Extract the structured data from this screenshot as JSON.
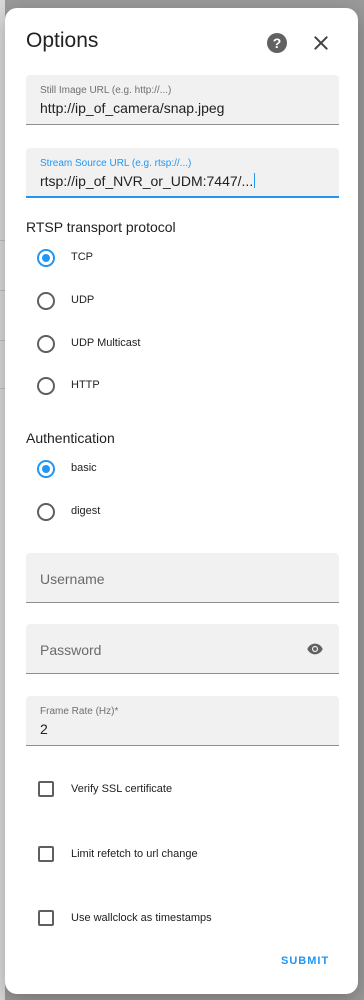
{
  "dialog": {
    "title": "Options",
    "help_icon": "help-circle-icon",
    "close_icon": "close-icon"
  },
  "fields": {
    "still_image": {
      "label": "Still Image URL (e.g. http://...)",
      "value": "http://ip_of_camera/snap.jpeg"
    },
    "stream_source": {
      "label": "Stream Source URL (e.g. rtsp://...)",
      "value": "rtsp://ip_of_NVR_or_UDM:7447/..."
    },
    "username": {
      "placeholder": "Username",
      "value": ""
    },
    "password": {
      "placeholder": "Password",
      "value": "",
      "toggle_icon": "eye-icon"
    },
    "frame_rate": {
      "label": "Frame Rate (Hz)*",
      "value": "2"
    }
  },
  "rtsp": {
    "title": "RTSP transport protocol",
    "options": [
      {
        "label": "TCP",
        "checked": true
      },
      {
        "label": "UDP",
        "checked": false
      },
      {
        "label": "UDP Multicast",
        "checked": false
      },
      {
        "label": "HTTP",
        "checked": false
      }
    ]
  },
  "auth": {
    "title": "Authentication",
    "options": [
      {
        "label": "basic",
        "checked": true
      },
      {
        "label": "digest",
        "checked": false
      }
    ]
  },
  "checkboxes": [
    {
      "label": "Verify SSL certificate",
      "checked": false
    },
    {
      "label": "Limit refetch to url change",
      "checked": false
    },
    {
      "label": "Use wallclock as timestamps",
      "checked": false
    }
  ],
  "actions": {
    "submit": "SUBMIT"
  },
  "colors": {
    "accent": "#2196f3",
    "field_bg": "#f1f1f1",
    "backdrop": "#9a9a9a"
  }
}
